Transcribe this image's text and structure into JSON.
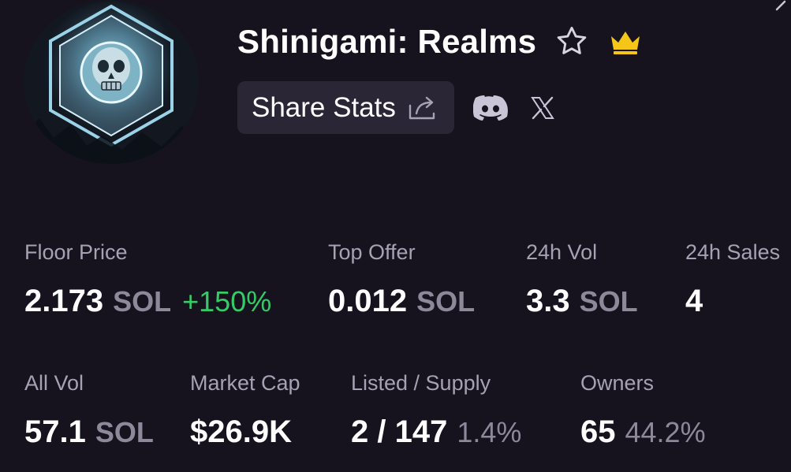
{
  "collection": {
    "name": "Shinigami: Realms"
  },
  "actions": {
    "share_label": "Share Stats"
  },
  "icons": {
    "favorite": "star-icon",
    "badge": "crown-icon",
    "share": "share-icon",
    "discord": "discord-icon",
    "x": "x-icon"
  },
  "colors": {
    "background": "#16131f",
    "positive": "#33cc66",
    "crown": "#f5c518",
    "muted": "#8d899a"
  },
  "stats": {
    "floor_price": {
      "label": "Floor Price",
      "value": "2.173",
      "unit": "SOL",
      "change": "+150%"
    },
    "top_offer": {
      "label": "Top Offer",
      "value": "0.012",
      "unit": "SOL"
    },
    "vol_24h": {
      "label": "24h Vol",
      "value": "3.3",
      "unit": "SOL"
    },
    "sales_24h": {
      "label": "24h Sales",
      "value": "4"
    },
    "all_vol": {
      "label": "All Vol",
      "value": "57.1",
      "unit": "SOL"
    },
    "market_cap": {
      "label": "Market Cap",
      "value": "$26.9K"
    },
    "listed_supply": {
      "label": "Listed / Supply",
      "value": "2 / 147",
      "pct": "1.4%"
    },
    "owners": {
      "label": "Owners",
      "value": "65",
      "pct": "44.2%"
    }
  }
}
